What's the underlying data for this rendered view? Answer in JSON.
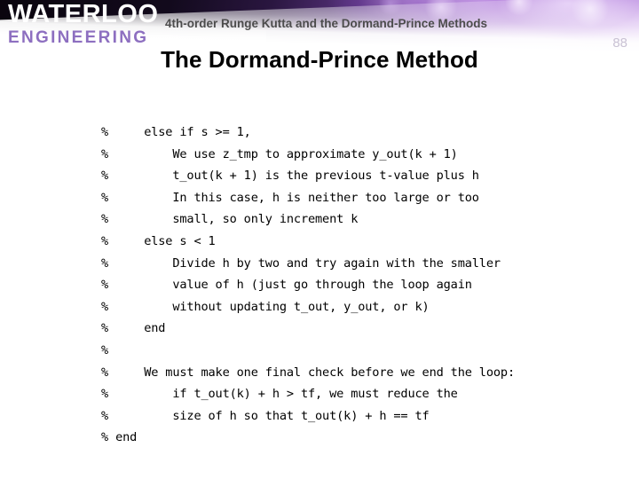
{
  "banner": {
    "logo_primary": "WATERLOO",
    "logo_secondary": "ENGINEERING",
    "subtitle": "4th-order Runge Kutta and the Dormand-Prince Methods",
    "page_number": "88",
    "colors": {
      "logo_primary": "#ffffff",
      "logo_secondary": "#8d6fc0",
      "subtitle": "#4c4c4c",
      "page_number": "#c9c2d4",
      "banner_dark": "#0a050e",
      "banner_accent": "#8f62b4"
    }
  },
  "slide": {
    "title": "The Dormand-Prince Method",
    "title_color": "#000000",
    "background": "#ffffff"
  },
  "code": {
    "language": "matlab",
    "comment_char": "%",
    "text_color": "#000000",
    "lines": [
      "%     else if s >= 1,",
      "%         We use z_tmp to approximate y_out(k + 1)",
      "%         t_out(k + 1) is the previous t-value plus h",
      "%         In this case, h is neither too large or too",
      "%         small, so only increment k",
      "%     else s < 1",
      "%         Divide h by two and try again with the smaller",
      "%         value of h (just go through the loop again",
      "%         without updating t_out, y_out, or k)",
      "%     end",
      "%",
      "%     We must make one final check before we end the loop:",
      "%         if t_out(k) + h > tf, we must reduce the",
      "%         size of h so that t_out(k) + h == tf",
      "% end"
    ]
  }
}
